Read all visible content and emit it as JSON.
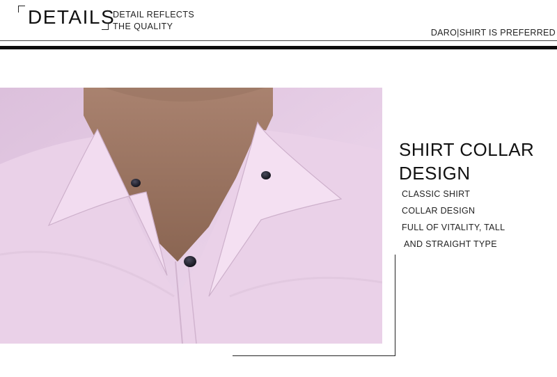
{
  "header": {
    "title": "DETAILS",
    "subtitle_line1": "DETAIL REFLECTS",
    "subtitle_line2": "THE QUALITY",
    "brand": "DARO|SHIRT IS PREFERRED"
  },
  "feature": {
    "title_line1": "SHIRT COLLAR",
    "title_line2": "DESIGN",
    "lines": [
      "CLASSIC SHIRT",
      "COLLAR DESIGN",
      "FULL OF VITALITY, TALL",
      "AND STRAIGHT TYPE"
    ]
  },
  "colors": {
    "shirt": "#e9d0e7",
    "button": "#1c1c2a",
    "rule": "#0b0b0b"
  }
}
